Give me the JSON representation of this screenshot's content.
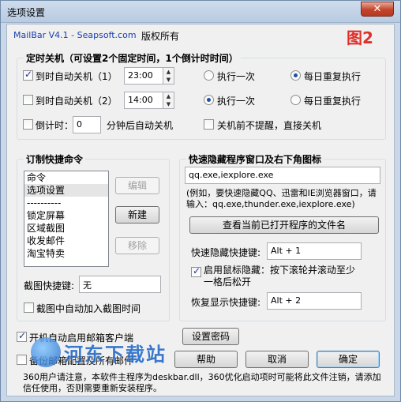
{
  "window": {
    "title": "选项设置",
    "close_glyph": "✕"
  },
  "header": {
    "app_name": "MailBar V4.1 - Seapsoft.com",
    "copyright": "版权所有",
    "figure_label": "图2"
  },
  "shutdown": {
    "title": "定时关机（可设置2个固定时间，1个倒计时时间）",
    "row1": {
      "label": "到时自动关机（1）",
      "checked": true,
      "time": "23:00",
      "once": "执行一次",
      "daily": "每日重复执行",
      "selected": "daily"
    },
    "row2": {
      "label": "到时自动关机（2）",
      "checked": false,
      "time": "14:00",
      "once": "执行一次",
      "daily": "每日重复执行",
      "selected": "once"
    },
    "countdown": {
      "label": "倒计时：",
      "value": "0",
      "suffix": "分钟后自动关机",
      "checked": false
    },
    "no_prompt": {
      "label": "关机前不提醒，直接关机",
      "checked": false
    }
  },
  "commands": {
    "title": "订制快捷命令",
    "items": [
      "命令",
      "选项设置",
      "----------",
      "锁定屏幕",
      "区域截图",
      "收发邮件",
      "淘宝特卖"
    ],
    "selected_index": 1,
    "edit_label": "编辑",
    "new_label": "新建",
    "remove_label": "移除",
    "screenshot_hotkey_label": "截图快捷键:",
    "screenshot_hotkey_value": "无",
    "auto_add_time_label": "截图中自动加入截图时间"
  },
  "hide": {
    "title": "快速隐藏程序窗口及右下角图标",
    "programs_value": "qq.exe,iexplore.exe",
    "example_text": "(例如，要快速隐藏QQ、迅雷和IE浏览器窗口，请输入：qq.exe,thunder.exe,iexplore.exe)",
    "view_button": "查看当前已打开程序的文件名",
    "hide_hotkey_label": "快速隐藏快捷键:",
    "hide_hotkey_value": "Alt + 1",
    "mouse_hide_label": "启用鼠标隐藏：按下滚轮并滚动至少一格后松开",
    "mouse_hide_checked": true,
    "restore_hotkey_label": "恢复显示快捷键:",
    "restore_hotkey_value": "Alt + 2"
  },
  "footer": {
    "autostart_label": "开机自动启用邮箱客户端",
    "autostart_checked": true,
    "backup_label": "备份邮箱配置及所有邮件",
    "backup_checked": false,
    "set_password": "设置密码",
    "help": "帮助",
    "cancel": "取消",
    "ok": "确定",
    "note": "360用户请注意，本软件主程序为deskbar.dll，360优化启动项时可能将此文件注销，请添加信任使用，否则需要重新安装程序。",
    "watermark": "河东下载站"
  }
}
